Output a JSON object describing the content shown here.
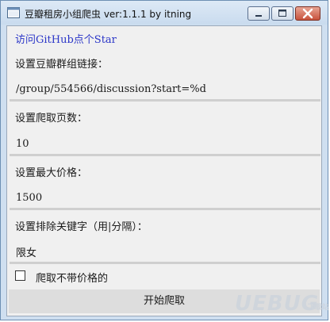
{
  "window": {
    "title": "豆瓣租房小组爬虫 ver:1.1.1 by itning"
  },
  "link": {
    "label": "访问GitHub点个Star"
  },
  "group_url": {
    "label": "设置豆瓣群组链接：",
    "value": "/group/554566/discussion?start=%d"
  },
  "pages": {
    "label": "设置爬取页数：",
    "value": "10"
  },
  "max_price": {
    "label": "设置最大价格：",
    "value": "1500"
  },
  "exclude_keywords": {
    "label": "设置排除关键字（用|分隔）：",
    "value": "限女"
  },
  "no_price_checkbox": {
    "label": "爬取不带价格的",
    "checked": false
  },
  "start_button": {
    "label": "开始爬取"
  },
  "watermark": {
    "text": "UEBUG",
    "sub": "下载站"
  },
  "colors": {
    "titlebar": "#c9dbee",
    "link": "#2b36c8",
    "close_button": "#c8523d",
    "client_bg": "#f0f0f0",
    "button_bg": "#dddddd"
  },
  "icons": [
    "app-icon",
    "minimize-icon",
    "maximize-icon",
    "close-icon",
    "checkbox-icon"
  ]
}
